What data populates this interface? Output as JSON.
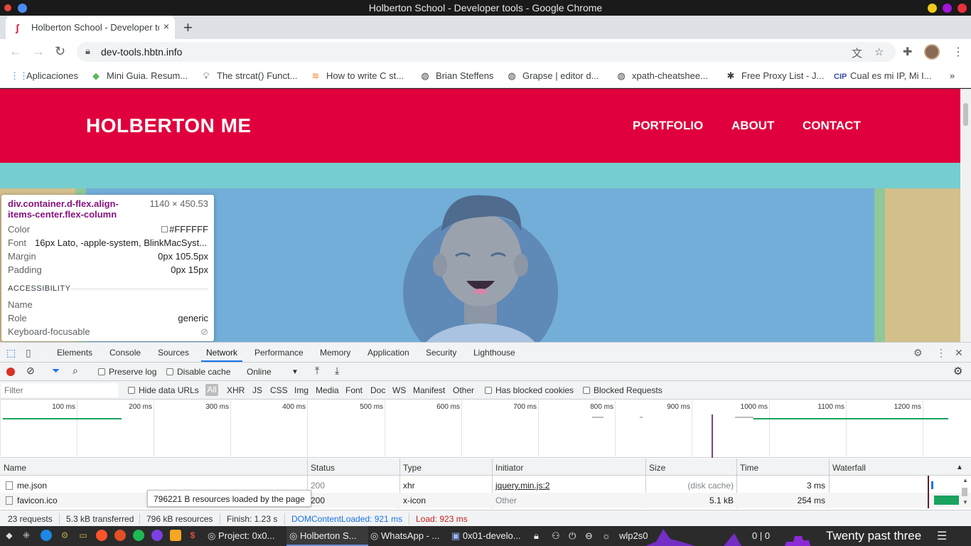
{
  "window": {
    "title": "Holberton School - Developer tools - Google Chrome",
    "control_colors": [
      "#f2c81b",
      "#a415d7",
      "#e8313c"
    ]
  },
  "tabs": [
    {
      "label": "Holberton School - Developer tools",
      "close": "×"
    }
  ],
  "new_tab": "+",
  "address_bar": {
    "url": "dev-tools.hbtn.info"
  },
  "bookmarks": [
    {
      "label": "Aplicaciones",
      "icon": "apps-grid-icon"
    },
    {
      "label": "Mini Guia. Resum...",
      "icon": "diamond-icon"
    },
    {
      "label": "The strcat() Funct...",
      "icon": "bulb-icon"
    },
    {
      "label": "How to write C st...",
      "icon": "stackoverflow-icon"
    },
    {
      "label": "Brian Steffens",
      "icon": "globe-icon"
    },
    {
      "label": "Grapse | editor d...",
      "icon": "globe-icon"
    },
    {
      "label": "xpath-cheatshee...",
      "icon": "globe-icon"
    },
    {
      "label": "Free Proxy List - J...",
      "icon": "ninja-icon"
    },
    {
      "label": "Cual es mi IP, Mi I...",
      "icon": "cip-icon"
    }
  ],
  "site": {
    "brand": "HOLBERTON ME",
    "nav": [
      "PORTFOLIO",
      "ABOUT",
      "CONTACT"
    ],
    "header_color": "#e0003d",
    "band_color": "#76cdd0",
    "hero_color": "#72aed8"
  },
  "inspect_tooltip": {
    "selector": "div.container.d-flex.align-items-center.flex-column",
    "dimensions": "1140 × 450.53",
    "rows": [
      {
        "key": "Color",
        "value": "#FFFFFF"
      },
      {
        "key": "Font",
        "value": "16px Lato, -apple-system, BlinkMacSyst..."
      },
      {
        "key": "Margin",
        "value": "0px 105.5px"
      },
      {
        "key": "Padding",
        "value": "0px 15px"
      }
    ],
    "section": "ACCESSIBILITY",
    "a11y": [
      {
        "key": "Name",
        "value": ""
      },
      {
        "key": "Role",
        "value": "generic"
      },
      {
        "key": "Keyboard-focusable",
        "value": ""
      }
    ]
  },
  "devtools": {
    "tabs": [
      "Elements",
      "Console",
      "Sources",
      "Network",
      "Performance",
      "Memory",
      "Application",
      "Security",
      "Lighthouse"
    ],
    "active_tab": "Network",
    "toolbar": {
      "preserve_log": "Preserve log",
      "disable_cache": "Disable cache",
      "throttle": "Online"
    },
    "filter": {
      "placeholder": "Filter",
      "hide_data_urls": "Hide data URLs",
      "types": [
        "All",
        "XHR",
        "JS",
        "CSS",
        "Img",
        "Media",
        "Font",
        "Doc",
        "WS",
        "Manifest",
        "Other"
      ],
      "has_blocked_cookies": "Has blocked cookies",
      "blocked_requests": "Blocked Requests"
    },
    "timeline_ticks": [
      "100 ms",
      "200 ms",
      "300 ms",
      "400 ms",
      "500 ms",
      "600 ms",
      "700 ms",
      "800 ms",
      "900 ms",
      "1000 ms",
      "1100 ms",
      "1200 ms"
    ],
    "columns": [
      "Name",
      "Status",
      "Type",
      "Initiator",
      "Size",
      "Time",
      "Waterfall"
    ],
    "rows": [
      {
        "name": "me.json",
        "status": "200",
        "type": "xhr",
        "initiator": "jquery.min.js:2",
        "size": "(disk cache)",
        "time": "3 ms"
      },
      {
        "name": "favicon.ico",
        "status": "200",
        "type": "x-icon",
        "initiator": "Other",
        "size": "5.1 kB",
        "time": "254 ms"
      }
    ],
    "hover_tooltip": "796221 B resources loaded by the page",
    "status": {
      "requests": "23 requests",
      "transferred": "5.3 kB transferred",
      "resources": "796 kB resources",
      "finish": "Finish: 1.23 s",
      "dom_loaded": "DOMContentLoaded: 921 ms",
      "load": "Load: 923 ms"
    }
  },
  "taskbar": {
    "items": [
      "Project: 0x0...",
      "Holberton S...",
      "WhatsApp - ...",
      "0x01-develo..."
    ],
    "network": "wlp2s0",
    "counter": "0 | 0",
    "clock": "Twenty past three"
  }
}
